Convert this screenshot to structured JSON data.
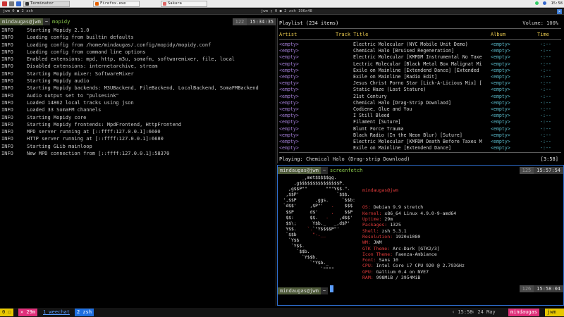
{
  "taskbar": {
    "tasks": [
      {
        "label": "Terminator"
      },
      {
        "label": "Firefox.exe"
      },
      {
        "label": "Sakura"
      }
    ],
    "clock": "15:58"
  },
  "window": {
    "left_label": "jwm 0 ● 2 zsh",
    "center_label": "jwm ▯ 0 ● 2 zsh 196x48",
    "close_glyph": "×"
  },
  "left_pane": {
    "prompt": {
      "user": "mindaugas",
      "host": "jwm",
      "cwd": "~",
      "command": "mopidy",
      "count": "122",
      "time": "15:34:35"
    },
    "log": [
      {
        "level": "INFO",
        "msg": "Starting Mopidy 2.1.0"
      },
      {
        "level": "INFO",
        "msg": "Loading config from builtin defaults"
      },
      {
        "level": "INFO",
        "msg": "Loading config from /home/mindaugas/.config/mopidy/mopidy.conf"
      },
      {
        "level": "INFO",
        "msg": "Loading config from command line options"
      },
      {
        "level": "INFO",
        "msg": "Enabled extensions: mpd, http, m3u, somafm, softwaremixer, file, local"
      },
      {
        "level": "INFO",
        "msg": "Disabled extensions: internetarchive, stream"
      },
      {
        "level": "INFO",
        "msg": "Starting Mopidy mixer: SoftwareMixer"
      },
      {
        "level": "INFO",
        "msg": "Starting Mopidy audio"
      },
      {
        "level": "INFO",
        "msg": "Starting Mopidy backends: M3UBackend, FileBackend, LocalBackend, SomaFMBackend"
      },
      {
        "level": "INFO",
        "msg": "Audio output set to \"pulsesink\""
      },
      {
        "level": "INFO",
        "msg": "Loaded 14862 local tracks using json"
      },
      {
        "level": "INFO",
        "msg": "Loaded 33 SomaFM channels"
      },
      {
        "level": "INFO",
        "msg": "Starting Mopidy core"
      },
      {
        "level": "INFO",
        "msg": "Starting Mopidy frontends: MpdFrontend, HttpFrontend"
      },
      {
        "level": "INFO",
        "msg": "MPD server running at [::ffff:127.0.0.1]:6600"
      },
      {
        "level": "INFO",
        "msg": "HTTP server running at [::ffff:127.0.0.1]:6680"
      },
      {
        "level": "INFO",
        "msg": "Starting GLib mainloop"
      },
      {
        "level": "INFO",
        "msg": "New MPD connection from [::ffff:127.0.0.1]:58370"
      }
    ]
  },
  "ncmpcpp": {
    "header": "Playlist (234 items)",
    "volume": "Volume: 100%",
    "columns": {
      "artist": "Artist",
      "title": "Track Title",
      "album": "Album",
      "time": "Time"
    },
    "rows": [
      {
        "artist": "<empty>",
        "title": "Electric Molecular (NYC Mobile Unit Demo)",
        "album": "<empty>",
        "time": "-:--"
      },
      {
        "artist": "<empty>",
        "title": "Chemical Halo [Bruised Regeneration]",
        "album": "<empty>",
        "time": "-:--"
      },
      {
        "artist": "<empty>",
        "title": "Electric Molecular [KMFDM Instrumental No Taxe",
        "album": "<empty>",
        "time": "-:--"
      },
      {
        "artist": "<empty>",
        "title": "Lectric Molecular [Black Metal Box Malignat Mi",
        "album": "<empty>",
        "time": "-:--"
      },
      {
        "artist": "<empty>",
        "title": "Exile on Mainline [Extendend Dance] [Extended",
        "album": "<empty>",
        "time": "-:--"
      },
      {
        "artist": "<empty>",
        "title": "Exile on Mainline [Radio Edit]",
        "album": "<empty>",
        "time": "-:--"
      },
      {
        "artist": "<empty>",
        "title": "Jesus Christ Porno Star [Lick-A-Licious Mix] [",
        "album": "<empty>",
        "time": "-:--"
      },
      {
        "artist": "<empty>",
        "title": "Static Haze (Lost Stature)",
        "album": "<empty>",
        "time": "-:--"
      },
      {
        "artist": "<empty>",
        "title": "21st Century",
        "album": "<empty>",
        "time": "-:--"
      },
      {
        "artist": "<empty>",
        "title": "Chemical Halo [Drag-Strip Downlaod]",
        "album": "<empty>",
        "time": "-:--"
      },
      {
        "artist": "<empty>",
        "title": "Codiene, Glue and You",
        "album": "<empty>",
        "time": "-:--"
      },
      {
        "artist": "<empty>",
        "title": "I Still Bleed",
        "album": "<empty>",
        "time": "-:--"
      },
      {
        "artist": "<empty>",
        "title": "Filament [Suture]",
        "album": "<empty>",
        "time": "-:--"
      },
      {
        "artist": "<empty>",
        "title": "Blunt Force Trauma",
        "album": "<empty>",
        "time": "-:--"
      },
      {
        "artist": "<empty>",
        "title": "Black Radio (In the Neon Blur) [Suture]",
        "album": "<empty>",
        "time": "-:--"
      },
      {
        "artist": "<empty>",
        "title": "Electric Molecular [KMFDM Death Before Taxes M",
        "album": "<empty>",
        "time": "-:--"
      },
      {
        "artist": "<empty>",
        "title": "Exile on Mainline [Extendend Dance]",
        "album": "<empty>",
        "time": "-:--"
      }
    ],
    "playing_label": "Playing:",
    "playing_title": "Chemical Halo (Drag-strip Download)",
    "playing_time": "[3:58]"
  },
  "screenfetch_pane": {
    "prompt": {
      "user": "mindaugas",
      "host": "jwm",
      "cwd": "~",
      "command": "screenfetch",
      "count": "125",
      "time": "15:57:54"
    },
    "user_host": "mindaugas@jwm",
    "info": [
      {
        "key": "OS:",
        "value": "Debian 9.9 stretch"
      },
      {
        "key": "Kernel:",
        "value": "x86_64 Linux 4.9.0-9-amd64"
      },
      {
        "key": "Uptime:",
        "value": "29m"
      },
      {
        "key": "Packages:",
        "value": "1325"
      },
      {
        "key": "Shell:",
        "value": "zsh 5.3.1"
      },
      {
        "key": "Resolution:",
        "value": "1920x1080"
      },
      {
        "key": "WM:",
        "value": "JWM"
      },
      {
        "key": "GTK Theme:",
        "value": "Arc-Dark [GTK2/3]"
      },
      {
        "key": "Icon Theme:",
        "value": "Faenza-Ambiance"
      },
      {
        "key": "Font:",
        "value": "Sans 10"
      },
      {
        "key": "CPU:",
        "value": "Intel Core i7 CPU 920 @ 2.793GHz"
      },
      {
        "key": "GPU:",
        "value": "Gallium 0.4 on NVE7"
      },
      {
        "key": "RAM:",
        "value": "998MiB / 3954MiB"
      }
    ],
    "prompt2": {
      "user": "mindaugas",
      "host": "jwm",
      "cwd": "~",
      "count": "126",
      "time": "15:58:04"
    }
  },
  "statusbar": {
    "left": [
      {
        "label": "0 ☐"
      },
      {
        "label": "✕ 29m"
      },
      {
        "label": "1 weechat"
      },
      {
        "label": "2 zsh"
      }
    ],
    "right": [
      {
        "label": "‹ 15:58"
      },
      {
        "label": "‹ 24 May"
      },
      {
        "label": "mindaugas"
      },
      {
        "label": "jwm"
      }
    ]
  },
  "colors": {
    "accent_blue": "#2e6fd0",
    "tmux_pink": "#e0307a",
    "tmux_yellow": "#e8c800",
    "playlist_header": "#e8c84e"
  }
}
